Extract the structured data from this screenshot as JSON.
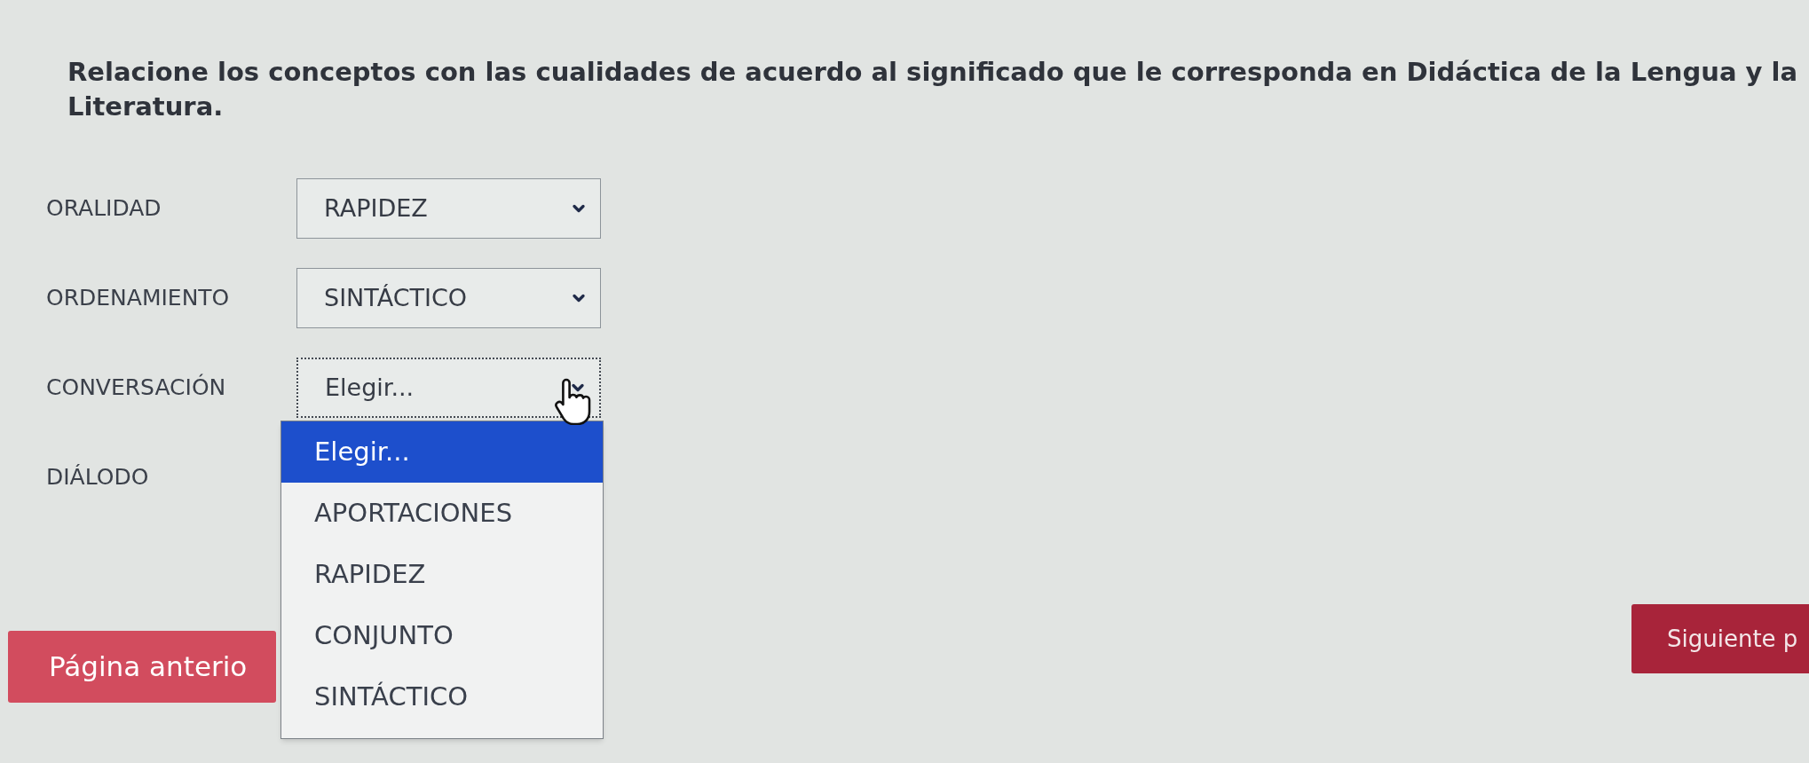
{
  "question": "Relacione los conceptos con las cualidades de acuerdo al significado que le corresponda en Didáctica de la Lengua y la Literatura.",
  "rows": [
    {
      "label": "ORALIDAD",
      "select": {
        "value": "RAPIDEZ",
        "open": false
      }
    },
    {
      "label": "ORDENAMIENTO",
      "select": {
        "value": "SINTÁCTICO",
        "open": false
      }
    },
    {
      "label": "CONVERSACIÓN",
      "select": {
        "value": "Elegir...",
        "open": true,
        "options": [
          {
            "label": "Elegir...",
            "selected": true
          },
          {
            "label": "APORTACIONES",
            "selected": false
          },
          {
            "label": "RAPIDEZ",
            "selected": false
          },
          {
            "label": "CONJUNTO",
            "selected": false
          },
          {
            "label": "SINTÁCTICO",
            "selected": false
          }
        ]
      }
    },
    {
      "label": "DIÁLODO"
    }
  ],
  "previous_button": {
    "label": "Página anterio"
  },
  "next_button": {
    "label": "Siguiente p"
  }
}
